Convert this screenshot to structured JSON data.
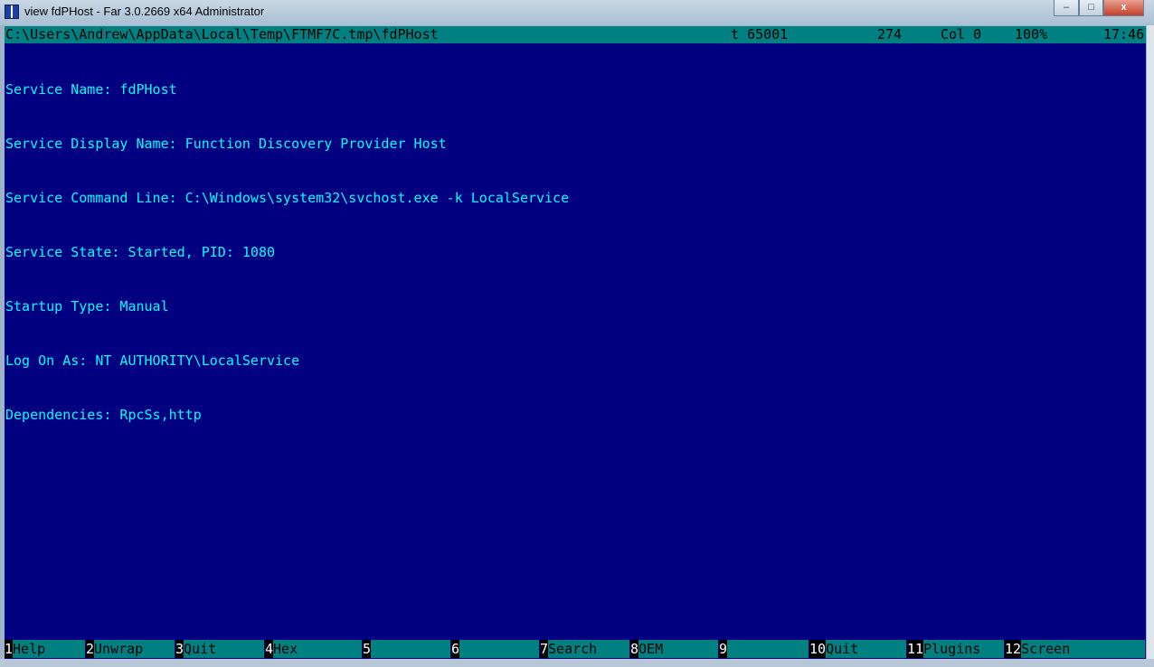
{
  "window": {
    "title": "view fdPHost - Far 3.0.2669 x64 Administrator",
    "minimize": "–",
    "maximize": "□",
    "close": "x"
  },
  "status": {
    "path": "C:\\Users\\Andrew\\AppData\\Local\\Temp\\FTMF7C.tmp\\fdPHost",
    "codepage": "t 65001",
    "size": "274",
    "col": "Col 0",
    "percent": "100%",
    "clock": "17:46"
  },
  "lines": [
    "Service Name: fdPHost",
    "Service Display Name: Function Discovery Provider Host",
    "Service Command Line: C:\\Windows\\system32\\svchost.exe -k LocalService",
    "Service State: Started, PID: 1080",
    "Startup Type: Manual",
    "Log On As: NT AUTHORITY\\LocalService",
    "Dependencies: RpcSs,http"
  ],
  "keybar": [
    {
      "n": "1",
      "l": "Help"
    },
    {
      "n": "2",
      "l": "Unwrap"
    },
    {
      "n": "3",
      "l": "Quit"
    },
    {
      "n": "4",
      "l": "Hex"
    },
    {
      "n": "5",
      "l": ""
    },
    {
      "n": "6",
      "l": ""
    },
    {
      "n": "7",
      "l": "Search"
    },
    {
      "n": "8",
      "l": "OEM"
    },
    {
      "n": "9",
      "l": ""
    },
    {
      "n": "10",
      "l": "Quit"
    },
    {
      "n": "11",
      "l": "Plugins"
    },
    {
      "n": "12",
      "l": "Screen"
    }
  ]
}
